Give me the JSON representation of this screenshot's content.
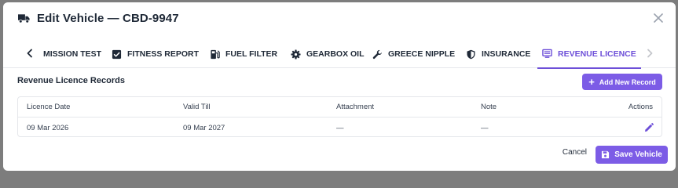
{
  "modal": {
    "title": "Edit Vehicle — CBD-9947",
    "close_icon": "close-icon"
  },
  "tabs": [
    {
      "label": "MISSION TEST",
      "icon": "none",
      "active": false
    },
    {
      "label": "FITNESS REPORT",
      "icon": "checkbox-icon",
      "active": false
    },
    {
      "label": "FUEL FILTER",
      "icon": "fuel-pump-icon",
      "active": false
    },
    {
      "label": "GEARBOX OIL",
      "icon": "gear-icon",
      "active": false
    },
    {
      "label": "GREECE NIPPLE",
      "icon": "wrench-icon",
      "active": false
    },
    {
      "label": "INSURANCE",
      "icon": "shield-icon",
      "active": false
    },
    {
      "label": "REVENUE LICENCE",
      "icon": "monitor-icon",
      "active": true
    }
  ],
  "section": {
    "title": "Revenue Licence Records",
    "add_label": "Add New Record"
  },
  "table": {
    "columns": [
      "Licence Date",
      "Valid Till",
      "Attachment",
      "Note",
      "Actions"
    ],
    "rows": [
      {
        "licence_date": "09 Mar 2026",
        "valid_till": "09 Mar 2027",
        "attachment": "—",
        "note": "—"
      }
    ]
  },
  "footer": {
    "cancel_label": "Cancel",
    "save_label": "Save Vehicle"
  },
  "colors": {
    "accent": "#7c5ce6",
    "active_tab": "#6d4fd8",
    "overlay": "#7d7d7d"
  }
}
